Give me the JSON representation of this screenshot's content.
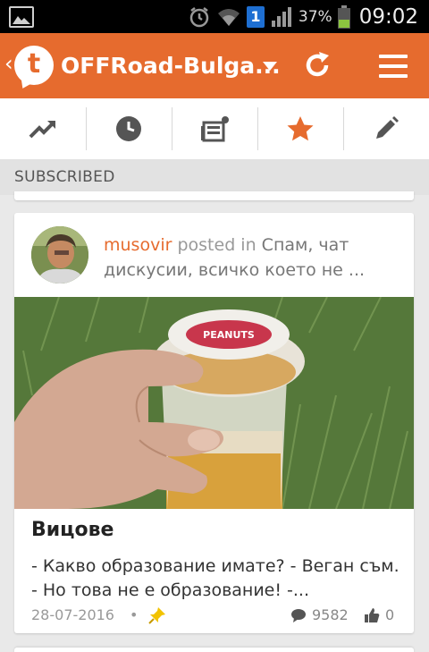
{
  "status_bar": {
    "battery_percent": "37%",
    "time": "09:02",
    "sim_label": "1",
    "icons": [
      "gallery-icon",
      "alarm-icon",
      "wifi-icon",
      "signal-icon",
      "battery-icon"
    ]
  },
  "app_bar": {
    "title": "OFFRoad-Bulga...",
    "logo_letter": "t",
    "back_glyph": "‹",
    "accent_color": "#e66b2e",
    "icons": [
      "back-icon",
      "tapatalk-logo-icon",
      "dropdown-icon",
      "refresh-icon",
      "menu-icon"
    ]
  },
  "tabs": [
    {
      "id": "trending",
      "icon": "trending-icon"
    },
    {
      "id": "recent",
      "icon": "clock-icon"
    },
    {
      "id": "unread",
      "icon": "news-icon"
    },
    {
      "id": "subscribed",
      "icon": "star-icon",
      "active": true
    },
    {
      "id": "compose",
      "icon": "pencil-icon"
    }
  ],
  "section": {
    "label": "SUBSCRIBED"
  },
  "post": {
    "author": "musovir",
    "posted_in": "posted in",
    "category": "Спам, чат дискусии, всичко което не ...",
    "title": "Вицове",
    "excerpt": "- Какво образование имате? - Веган съм. - Но това не е образование! -...",
    "date": "28-07-2016",
    "separator": "•",
    "comments": "9582",
    "likes": "0",
    "photo_label": "PEANUTS"
  }
}
